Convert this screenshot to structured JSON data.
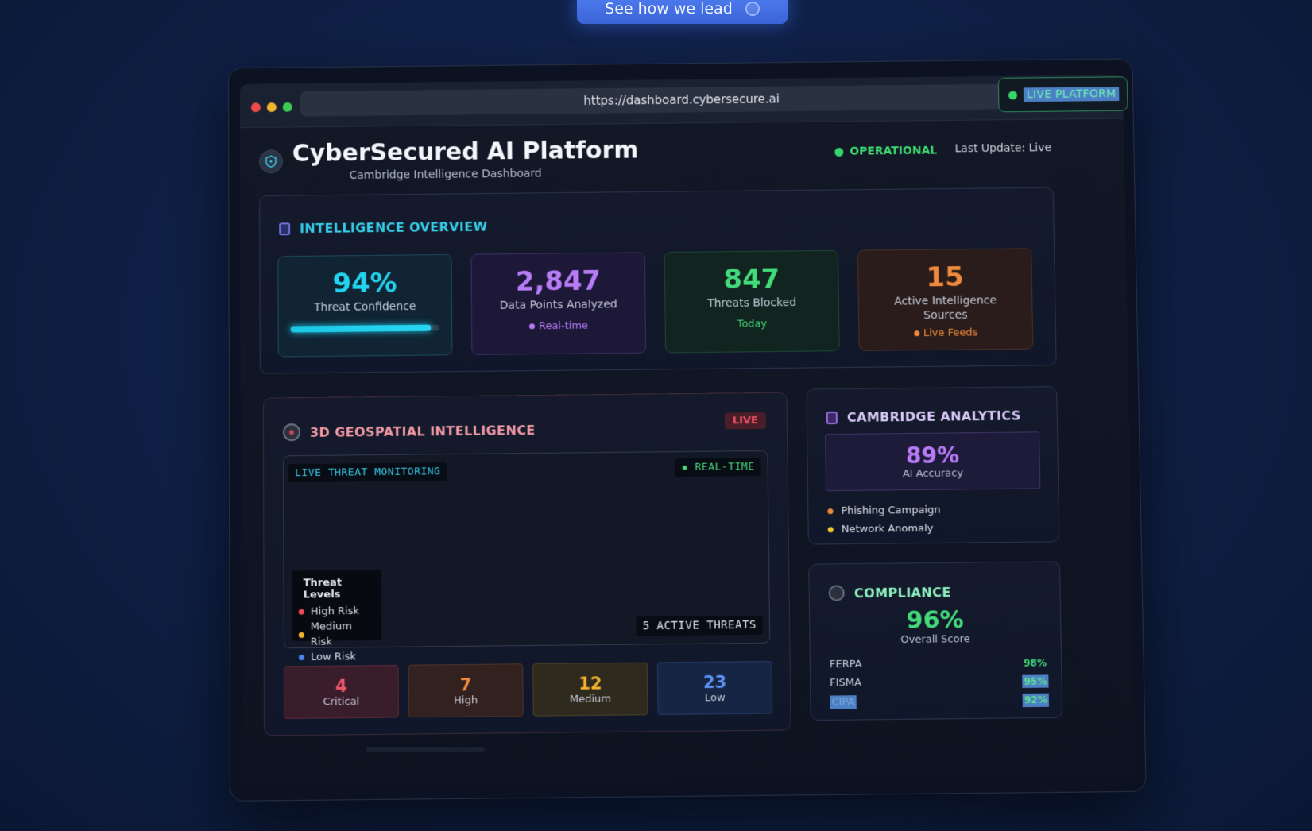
{
  "cta": {
    "label": "See how we lead"
  },
  "browser": {
    "url": "https://dashboard.cybersecure.ai",
    "live_badge": "LIVE PLATFORM"
  },
  "header": {
    "title": "CyberSecured AI Platform",
    "subtitle": "Cambridge Intelligence Dashboard",
    "status": "OPERATIONAL",
    "last_update": "Last Update: Live"
  },
  "overview": {
    "title": "INTELLIGENCE OVERVIEW",
    "cards": [
      {
        "value": "94%",
        "label": "Threat Confidence",
        "progress": 0.94,
        "color": "#23d3f0"
      },
      {
        "value": "2,847",
        "label": "Data Points Analyzed",
        "sub": "Real-time",
        "color": "#b77cf6"
      },
      {
        "value": "847",
        "label": "Threats Blocked",
        "sub": "Today",
        "color": "#43db7a"
      },
      {
        "value": "15",
        "label": "Active Intelligence Sources",
        "sub": "Live Feeds",
        "color": "#f08a3c"
      }
    ]
  },
  "geo": {
    "title": "3D GEOSPATIAL INTELLIGENCE",
    "badge": "LIVE",
    "monitor_tag": "LIVE THREAT MONITORING",
    "realtime_tag": "REAL-TIME",
    "active_threats": "5 ACTIVE THREATS",
    "legend": {
      "title": "Threat Levels",
      "items": [
        {
          "label": "High Risk",
          "color": "#ef4b5a"
        },
        {
          "label": "Medium Risk",
          "color": "#f3b130"
        },
        {
          "label": "Low Risk",
          "color": "#4b86f0"
        }
      ]
    },
    "severity": [
      {
        "count": "4",
        "label": "Critical",
        "color": "#f0566a",
        "bg": "#3a1d2a",
        "border": "#5a2a38"
      },
      {
        "count": "7",
        "label": "High",
        "color": "#f08a3c",
        "bg": "#33211f",
        "border": "#4f3328"
      },
      {
        "count": "12",
        "label": "Medium",
        "color": "#f3b130",
        "bg": "#2f2a1e",
        "border": "#4c4128"
      },
      {
        "count": "23",
        "label": "Low",
        "color": "#5b93f5",
        "bg": "#172544",
        "border": "#253a66"
      }
    ]
  },
  "analytics": {
    "title": "CAMBRIDGE ANALYTICS",
    "accuracy": "89%",
    "accuracy_label": "AI Accuracy",
    "items": [
      {
        "label": "Phishing Campaign",
        "color": "#f08a3c"
      },
      {
        "label": "Network Anomaly",
        "color": "#f3c530"
      }
    ]
  },
  "compliance": {
    "title": "COMPLIANCE",
    "score": "96%",
    "score_label": "Overall Score",
    "rows": [
      {
        "name": "FERPA",
        "value": "98%"
      },
      {
        "name": "FISMA",
        "value": "95%"
      },
      {
        "name": "CIPA",
        "value": "92%"
      }
    ]
  }
}
